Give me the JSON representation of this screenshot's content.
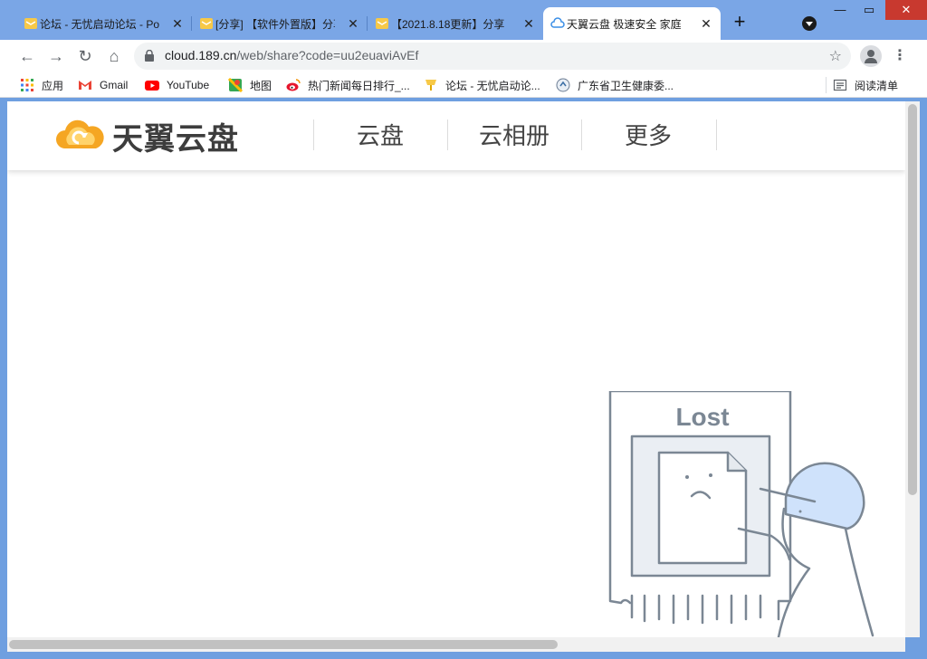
{
  "browser": {
    "tabs": [
      {
        "title": "论坛 - 无忧启动论坛 - Po",
        "favicon": "forum-icon",
        "active": false
      },
      {
        "title": "[分享] 【软件外置版】分享",
        "favicon": "forum-icon",
        "active": false
      },
      {
        "title": "【2021.8.18更新】分享",
        "favicon": "forum-icon",
        "active": false
      },
      {
        "title": "天翼云盘 极速安全 家庭",
        "favicon": "cloud-icon",
        "active": true
      }
    ],
    "url_host": "cloud.189.cn",
    "url_path": "/web/share?code=uu2euaviAvEf",
    "bookmarks": [
      {
        "label": "应用",
        "icon": "apps-grid-icon"
      },
      {
        "label": "Gmail",
        "icon": "gmail-icon"
      },
      {
        "label": "YouTube",
        "icon": "youtube-icon"
      },
      {
        "label": "地图",
        "icon": "maps-icon"
      },
      {
        "label": "热门新闻每日排行_...",
        "icon": "weibo-icon"
      },
      {
        "label": "论坛 - 无忧启动论...",
        "icon": "forum-icon"
      },
      {
        "label": "广东省卫生健康委...",
        "icon": "health-icon"
      }
    ],
    "reading_list": "阅读清单"
  },
  "site": {
    "logo_text": "天翼云盘",
    "nav": [
      "云盘",
      "云相册",
      "更多"
    ]
  },
  "illustration": {
    "sign_text": "Lost"
  },
  "colors": {
    "tab_strip": "#7aa6e6",
    "logo_orange": "#f5a623",
    "illustration_stroke": "#7b8794",
    "helmet_blue": "#cfe2fb"
  }
}
